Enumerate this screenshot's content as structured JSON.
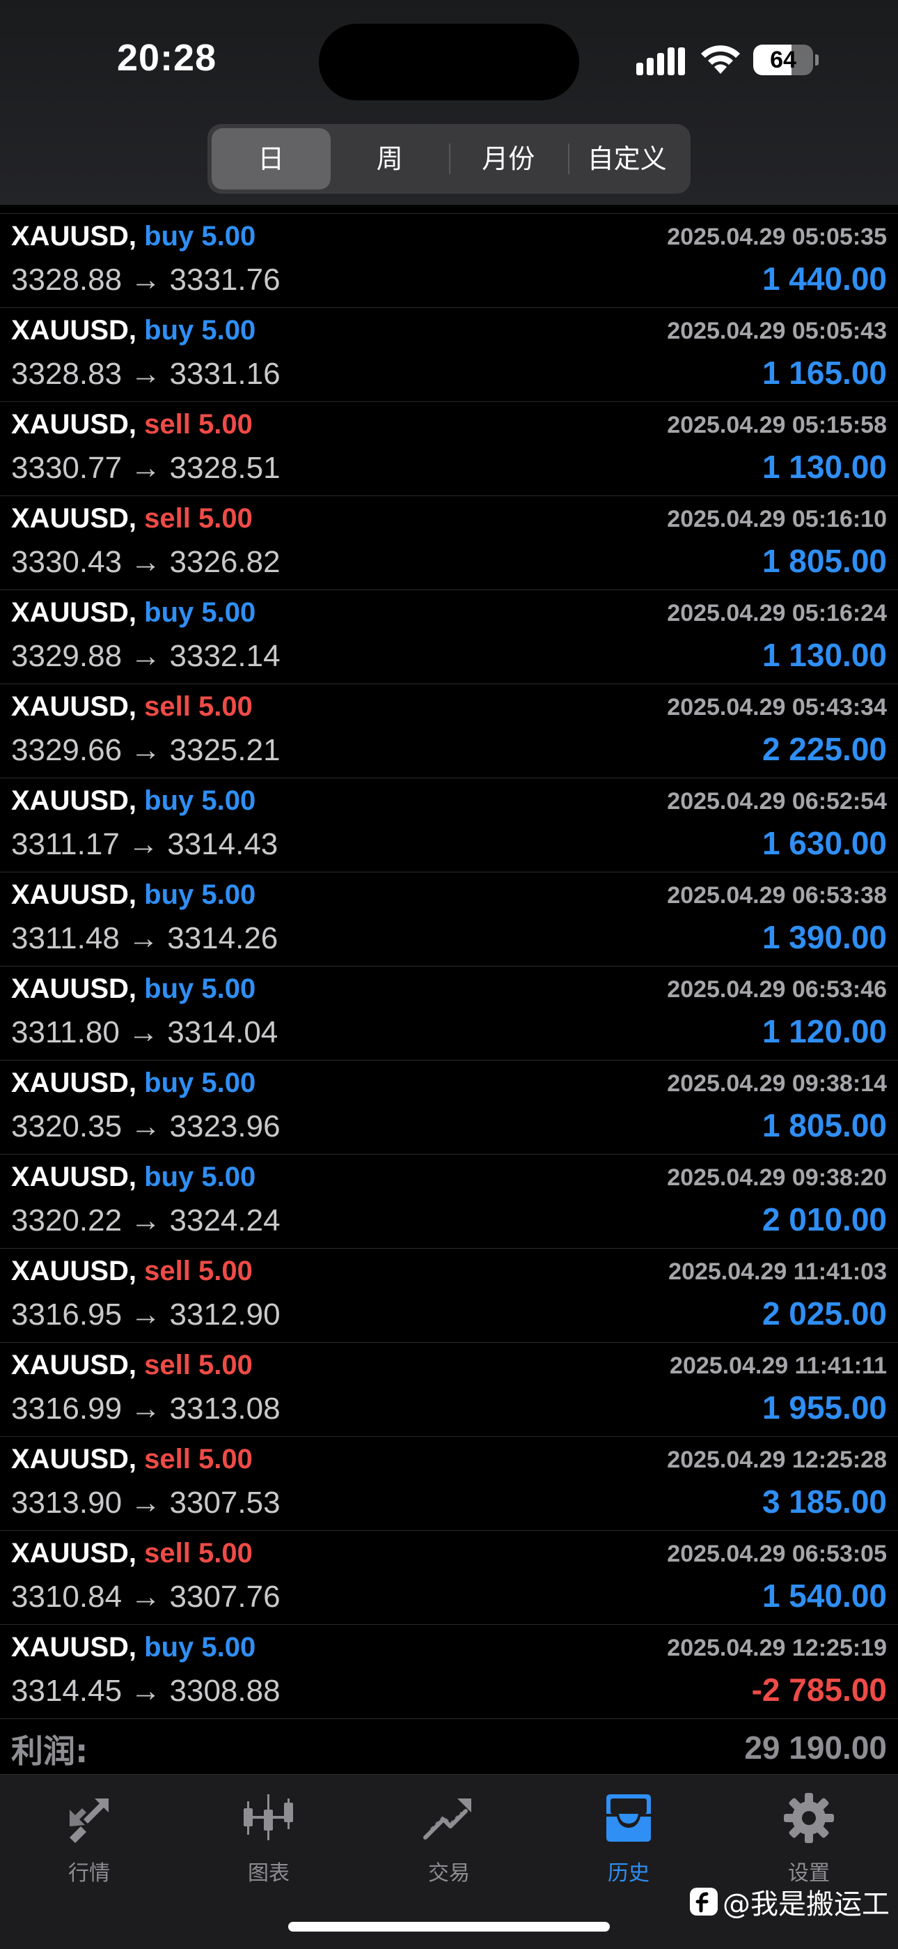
{
  "status_bar": {
    "time": "20:28",
    "battery": "64",
    "battery_level": 0.64
  },
  "period_tabs": [
    {
      "label": "日",
      "active": true
    },
    {
      "label": "周",
      "active": false
    },
    {
      "label": "月份",
      "active": false
    },
    {
      "label": "自定义",
      "active": false
    }
  ],
  "trades": [
    {
      "symbol": "XAUUSD,",
      "side": "buy",
      "side_label": "buy 5.00",
      "prices": "3328.88 → 3331.76",
      "time": "2025.04.29 05:05:35",
      "profit": "1 440.00"
    },
    {
      "symbol": "XAUUSD,",
      "side": "buy",
      "side_label": "buy 5.00",
      "prices": "3328.83 → 3331.16",
      "time": "2025.04.29 05:05:43",
      "profit": "1 165.00"
    },
    {
      "symbol": "XAUUSD,",
      "side": "sell",
      "side_label": "sell 5.00",
      "prices": "3330.77 → 3328.51",
      "time": "2025.04.29 05:15:58",
      "profit": "1 130.00"
    },
    {
      "symbol": "XAUUSD,",
      "side": "sell",
      "side_label": "sell 5.00",
      "prices": "3330.43 → 3326.82",
      "time": "2025.04.29 05:16:10",
      "profit": "1 805.00"
    },
    {
      "symbol": "XAUUSD,",
      "side": "buy",
      "side_label": "buy 5.00",
      "prices": "3329.88 → 3332.14",
      "time": "2025.04.29 05:16:24",
      "profit": "1 130.00"
    },
    {
      "symbol": "XAUUSD,",
      "side": "sell",
      "side_label": "sell 5.00",
      "prices": "3329.66 → 3325.21",
      "time": "2025.04.29 05:43:34",
      "profit": "2 225.00"
    },
    {
      "symbol": "XAUUSD,",
      "side": "buy",
      "side_label": "buy 5.00",
      "prices": "3311.17 → 3314.43",
      "time": "2025.04.29 06:52:54",
      "profit": "1 630.00"
    },
    {
      "symbol": "XAUUSD,",
      "side": "buy",
      "side_label": "buy 5.00",
      "prices": "3311.48 → 3314.26",
      "time": "2025.04.29 06:53:38",
      "profit": "1 390.00"
    },
    {
      "symbol": "XAUUSD,",
      "side": "buy",
      "side_label": "buy 5.00",
      "prices": "3311.80 → 3314.04",
      "time": "2025.04.29 06:53:46",
      "profit": "1 120.00"
    },
    {
      "symbol": "XAUUSD,",
      "side": "buy",
      "side_label": "buy 5.00",
      "prices": "3320.35 → 3323.96",
      "time": "2025.04.29 09:38:14",
      "profit": "1 805.00"
    },
    {
      "symbol": "XAUUSD,",
      "side": "buy",
      "side_label": "buy 5.00",
      "prices": "3320.22 → 3324.24",
      "time": "2025.04.29 09:38:20",
      "profit": "2 010.00"
    },
    {
      "symbol": "XAUUSD,",
      "side": "sell",
      "side_label": "sell 5.00",
      "prices": "3316.95 → 3312.90",
      "time": "2025.04.29 11:41:03",
      "profit": "2 025.00"
    },
    {
      "symbol": "XAUUSD,",
      "side": "sell",
      "side_label": "sell 5.00",
      "prices": "3316.99 → 3313.08",
      "time": "2025.04.29 11:41:11",
      "profit": "1 955.00"
    },
    {
      "symbol": "XAUUSD,",
      "side": "sell",
      "side_label": "sell 5.00",
      "prices": "3313.90 → 3307.53",
      "time": "2025.04.29 12:25:28",
      "profit": "3 185.00"
    },
    {
      "symbol": "XAUUSD,",
      "side": "sell",
      "side_label": "sell 5.00",
      "prices": "3310.84 → 3307.76",
      "time": "2025.04.29 06:53:05",
      "profit": "1 540.00"
    },
    {
      "symbol": "XAUUSD,",
      "side": "buy",
      "side_label": "buy 5.00",
      "prices": "3314.45 → 3308.88",
      "time": "2025.04.29 12:25:19",
      "profit": "-2 785.00"
    }
  ],
  "summary": {
    "label": "利润:",
    "value": "29 190.00"
  },
  "tab_bar": [
    {
      "label": "行情",
      "icon": "quotes-icon",
      "active": false
    },
    {
      "label": "图表",
      "icon": "chart-icon",
      "active": false
    },
    {
      "label": "交易",
      "icon": "trade-icon",
      "active": false
    },
    {
      "label": "历史",
      "icon": "history-icon",
      "active": true
    },
    {
      "label": "设置",
      "icon": "settings-icon",
      "active": false
    }
  ],
  "watermark": "@我是搬运工",
  "colors": {
    "buy": "#2f8ff5",
    "sell": "#ef4b47",
    "profit_positive": "#2f8ff5",
    "profit_negative": "#ef4b47",
    "tab_active": "#2f8ff5",
    "tab_inactive": "#8e8e93"
  }
}
